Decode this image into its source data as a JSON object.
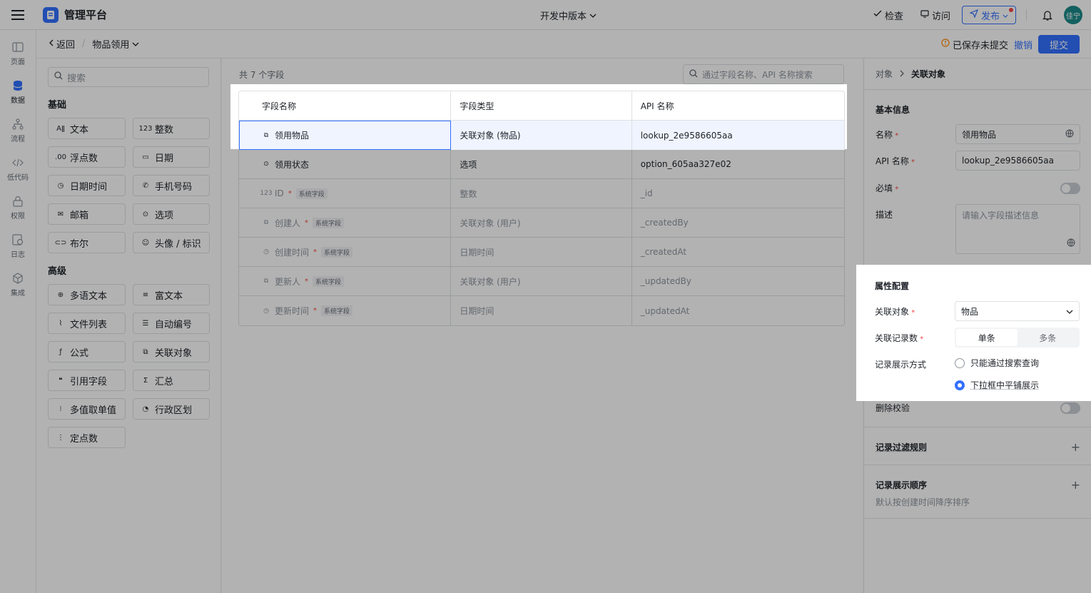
{
  "app": {
    "title": "管理平台",
    "env": "开发中版本",
    "avatar": "佳宁"
  },
  "top": {
    "check": "检查",
    "visit": "访问",
    "publish": "发布"
  },
  "nav": [
    {
      "label": "页面",
      "icon": "page-icon"
    },
    {
      "label": "数据",
      "icon": "database-icon"
    },
    {
      "label": "流程",
      "icon": "flow-icon"
    },
    {
      "label": "低代码",
      "icon": "code-icon"
    },
    {
      "label": "权限",
      "icon": "lock-icon"
    },
    {
      "label": "日志",
      "icon": "log-icon"
    },
    {
      "label": "集成",
      "icon": "integration-icon"
    }
  ],
  "sub": {
    "back": "返回",
    "object": "物品领用",
    "saved": "已保存未提交",
    "undo": "撤销",
    "submit": "提交"
  },
  "palette": {
    "search_placeholder": "搜索",
    "basic_title": "基础",
    "basic": [
      {
        "label": "文本",
        "icon": "Aǁ"
      },
      {
        "label": "整数",
        "icon": "123"
      },
      {
        "label": "浮点数",
        "icon": ".00"
      },
      {
        "label": "日期",
        "icon": "▭"
      },
      {
        "label": "日期时间",
        "icon": "◷"
      },
      {
        "label": "手机号码",
        "icon": "✆"
      },
      {
        "label": "邮箱",
        "icon": "✉"
      },
      {
        "label": "选项",
        "icon": "⊙"
      },
      {
        "label": "布尔",
        "icon": "⊂⊃"
      },
      {
        "label": "头像 / 标识",
        "icon": "☺"
      }
    ],
    "advanced_title": "高级",
    "advanced": [
      {
        "label": "多语文本",
        "icon": "⊕"
      },
      {
        "label": "富文本",
        "icon": "≡"
      },
      {
        "label": "文件列表",
        "icon": "⌇"
      },
      {
        "label": "自动编号",
        "icon": "☰"
      },
      {
        "label": "公式",
        "icon": "ƒ"
      },
      {
        "label": "关联对象",
        "icon": "⧉"
      },
      {
        "label": "引用字段",
        "icon": "❝"
      },
      {
        "label": "汇总",
        "icon": "Σ"
      },
      {
        "label": "多值取单值",
        "icon": "⁝"
      },
      {
        "label": "行政区划",
        "icon": "◔"
      },
      {
        "label": "定点数",
        "icon": "⋮"
      }
    ]
  },
  "table": {
    "count": "共 7 个字段",
    "search_placeholder": "通过字段名称、API 名称搜索",
    "headers": [
      "字段名称",
      "字段类型",
      "API 名称"
    ],
    "rows": [
      {
        "name": "领用物品",
        "type": "关联对象 (物品)",
        "api": "lookup_2e9586605aa",
        "icon": "⧉",
        "req": "",
        "sys": ""
      },
      {
        "name": "领用状态",
        "type": "选项",
        "api": "option_605aa327e02",
        "icon": "⊙",
        "req": "",
        "sys": ""
      },
      {
        "name": "ID",
        "type": "整数",
        "api": "_id",
        "icon": "123",
        "req": "*",
        "sys": "系统字段"
      },
      {
        "name": "创建人",
        "type": "关联对象 (用户)",
        "api": "_createdBy",
        "icon": "⧉",
        "req": "*",
        "sys": "系统字段"
      },
      {
        "name": "创建时间",
        "type": "日期时间",
        "api": "_createdAt",
        "icon": "◷",
        "req": "*",
        "sys": "系统字段"
      },
      {
        "name": "更新人",
        "type": "关联对象 (用户)",
        "api": "_updatedBy",
        "icon": "⧉",
        "req": "*",
        "sys": "系统字段"
      },
      {
        "name": "更新时间",
        "type": "日期时间",
        "api": "_updatedAt",
        "icon": "◷",
        "req": "*",
        "sys": "系统字段"
      }
    ]
  },
  "panel": {
    "crumb1": "对象",
    "crumb2": "关联对象",
    "basic_title": "基本信息",
    "name_label": "名称",
    "name_value": "领用物品",
    "api_label": "API 名称",
    "api_value": "lookup_2e9586605aa",
    "required_label": "必填",
    "desc_label": "描述",
    "desc_placeholder": "请输入字段描述信息",
    "attr_title": "属性配置",
    "lookup_label": "关联对象",
    "lookup_value": "物品",
    "count_label": "关联记录数",
    "single": "单条",
    "multi": "多条",
    "display_label": "记录展示方式",
    "opt1": "只能通过搜索查询",
    "opt2": "下拉框中平铺展示",
    "delete_label": "删除校验",
    "filter_title": "记录过滤规则",
    "order_title": "记录展示顺序",
    "order_hint": "默认按创建时间降序排序"
  }
}
